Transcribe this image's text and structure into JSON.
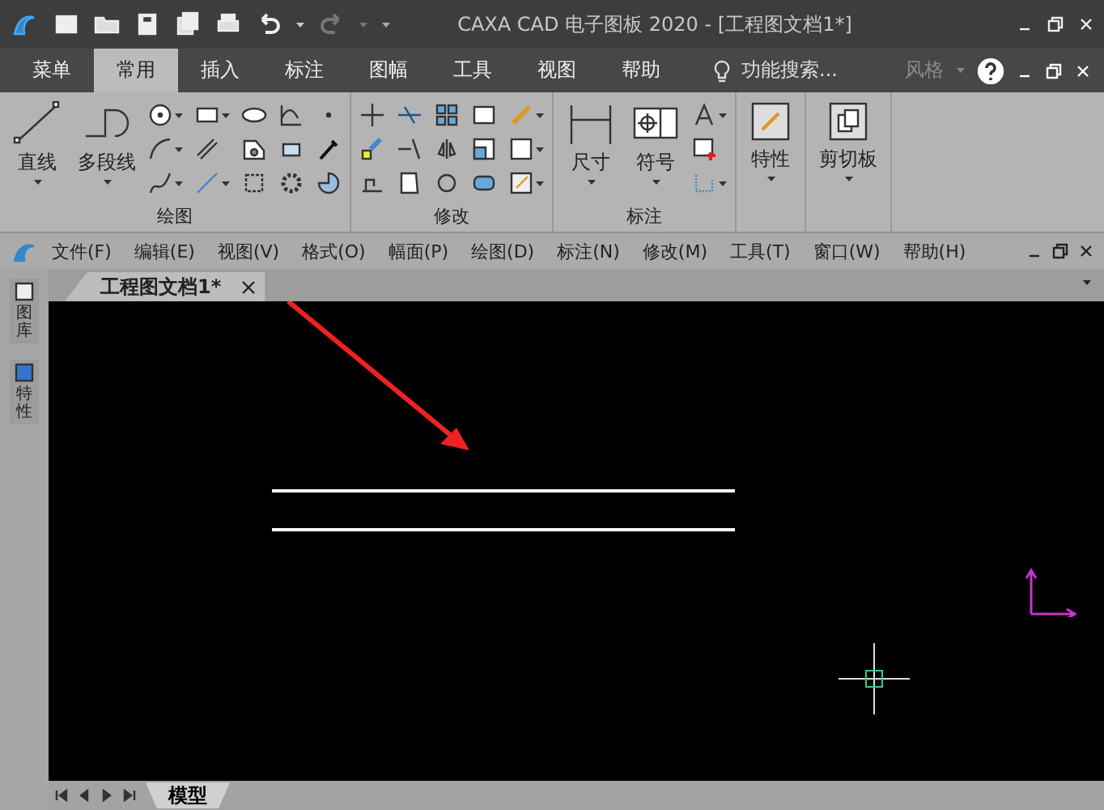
{
  "window": {
    "title": "CAXA CAD 电子图板 2020 - [工程图文档1*]"
  },
  "ribbon_tabs": [
    {
      "label": "菜单",
      "selected": false
    },
    {
      "label": "常用",
      "selected": true
    },
    {
      "label": "插入",
      "selected": false
    },
    {
      "label": "标注",
      "selected": false
    },
    {
      "label": "图幅",
      "selected": false
    },
    {
      "label": "工具",
      "selected": false
    },
    {
      "label": "视图",
      "selected": false
    },
    {
      "label": "帮助",
      "selected": false
    }
  ],
  "search": {
    "placeholder": "功能搜索..."
  },
  "style_label": "风格",
  "ribbon_groups": [
    {
      "kind": "draw",
      "title": "绘图",
      "large_buttons": [
        "直线",
        "多段线"
      ]
    },
    {
      "kind": "modify",
      "title": "修改"
    },
    {
      "kind": "annotate",
      "title": "标注",
      "large_buttons": [
        "尺寸",
        "符号"
      ]
    },
    {
      "kind": "properties",
      "large_buttons": [
        "特性"
      ]
    },
    {
      "kind": "clipboard",
      "large_buttons": [
        "剪切板"
      ]
    }
  ],
  "menu_bar": [
    "文件(F)",
    "编辑(E)",
    "视图(V)",
    "格式(O)",
    "幅面(P)",
    "绘图(D)",
    "标注(N)",
    "修改(M)",
    "工具(T)",
    "窗口(W)",
    "帮助(H)"
  ],
  "document_tab": {
    "label": "工程图文档1*"
  },
  "side_tabs": [
    "图库",
    "特性"
  ],
  "model_tabs": [
    {
      "label": "模型",
      "selected": true
    }
  ]
}
